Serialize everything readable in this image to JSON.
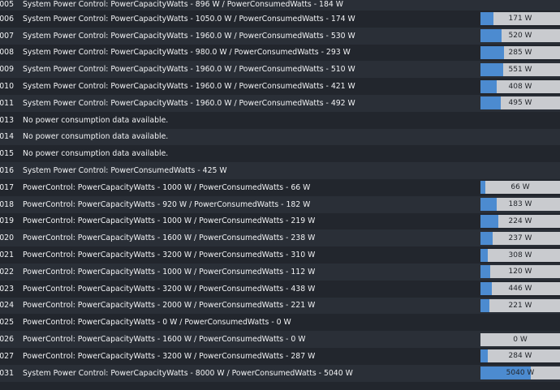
{
  "rows": [
    {
      "id": "005",
      "text": "System Power Control: PowerCapacityWatts - 896 W / PowerConsumedWatts - 184 W",
      "bar": null
    },
    {
      "id": "006",
      "text": "System Power Control: PowerCapacityWatts - 1050.0 W / PowerConsumedWatts - 174 W",
      "bar": {
        "label": "171 W",
        "fraction": 0.163
      }
    },
    {
      "id": "007",
      "text": "System Power Control: PowerCapacityWatts - 1960.0 W / PowerConsumedWatts - 530 W",
      "bar": {
        "label": "520 W",
        "fraction": 0.265
      }
    },
    {
      "id": "008",
      "text": "System Power Control: PowerCapacityWatts - 980.0 W / PowerConsumedWatts - 293 W",
      "bar": {
        "label": "285 W",
        "fraction": 0.291
      }
    },
    {
      "id": "009",
      "text": "System Power Control: PowerCapacityWatts - 1960.0 W / PowerConsumedWatts - 510 W",
      "bar": {
        "label": "551 W",
        "fraction": 0.281
      }
    },
    {
      "id": "010",
      "text": "System Power Control: PowerCapacityWatts - 1960.0 W / PowerConsumedWatts - 421 W",
      "bar": {
        "label": "408 W",
        "fraction": 0.208
      }
    },
    {
      "id": "011",
      "text": "System Power Control: PowerCapacityWatts - 1960.0 W / PowerConsumedWatts - 492 W",
      "bar": {
        "label": "495 W",
        "fraction": 0.253
      }
    },
    {
      "id": "013",
      "text": "No power consumption data available.",
      "bar": null
    },
    {
      "id": "014",
      "text": "No power consumption data available.",
      "bar": null
    },
    {
      "id": "015",
      "text": "No power consumption data available.",
      "bar": null
    },
    {
      "id": "016",
      "text": "System Power Control: PowerConsumedWatts - 425 W",
      "bar": null
    },
    {
      "id": "017",
      "text": "PowerControl: PowerCapacityWatts - 1000 W / PowerConsumedWatts - 66 W",
      "bar": {
        "label": "66 W",
        "fraction": 0.066
      }
    },
    {
      "id": "018",
      "text": "PowerControl: PowerCapacityWatts - 920 W / PowerConsumedWatts - 182 W",
      "bar": {
        "label": "183 W",
        "fraction": 0.199
      }
    },
    {
      "id": "019",
      "text": "PowerControl: PowerCapacityWatts - 1000 W / PowerConsumedWatts - 219 W",
      "bar": {
        "label": "224 W",
        "fraction": 0.224
      }
    },
    {
      "id": "020",
      "text": "PowerControl: PowerCapacityWatts - 1600 W / PowerConsumedWatts - 238 W",
      "bar": {
        "label": "237 W",
        "fraction": 0.148
      }
    },
    {
      "id": "021",
      "text": "PowerControl: PowerCapacityWatts - 3200 W / PowerConsumedWatts - 310 W",
      "bar": {
        "label": "308 W",
        "fraction": 0.096
      }
    },
    {
      "id": "022",
      "text": "PowerControl: PowerCapacityWatts - 1000 W / PowerConsumedWatts - 112 W",
      "bar": {
        "label": "120 W",
        "fraction": 0.12
      }
    },
    {
      "id": "023",
      "text": "PowerControl: PowerCapacityWatts - 3200 W / PowerConsumedWatts - 438 W",
      "bar": {
        "label": "446 W",
        "fraction": 0.139
      }
    },
    {
      "id": "024",
      "text": "PowerControl: PowerCapacityWatts - 2000 W / PowerConsumedWatts - 221 W",
      "bar": {
        "label": "221 W",
        "fraction": 0.11
      }
    },
    {
      "id": "025",
      "text": "PowerControl: PowerCapacityWatts - 0 W / PowerConsumedWatts - 0 W",
      "bar": null
    },
    {
      "id": "026",
      "text": "PowerControl: PowerCapacityWatts - 1600 W / PowerConsumedWatts - 0 W",
      "bar": {
        "label": "0 W",
        "fraction": 0.0
      }
    },
    {
      "id": "027",
      "text": "PowerControl: PowerCapacityWatts - 3200 W / PowerConsumedWatts - 287 W",
      "bar": {
        "label": "284 W",
        "fraction": 0.089
      }
    },
    {
      "id": "031",
      "text": "System Power Control: PowerCapacityWatts - 8000 W / PowerConsumedWatts - 5040 W",
      "bar": {
        "label": "5040 W",
        "fraction": 0.63
      }
    }
  ],
  "colors": {
    "row_even": "#2a2f37",
    "row_odd": "#22262d",
    "bar_fill": "#4c8bd0",
    "bar_track": "#c9cbcf",
    "text": "#f2f3f5"
  }
}
